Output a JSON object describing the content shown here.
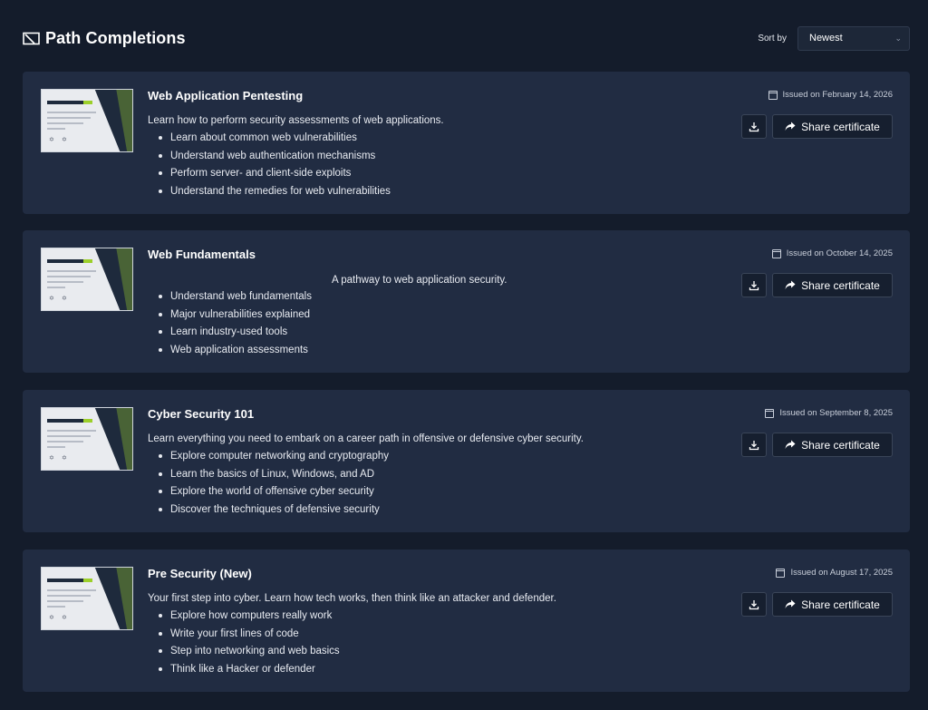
{
  "header": {
    "title": "Path Completions",
    "sort_label": "Sort by",
    "sort_value": "Newest"
  },
  "cards": [
    {
      "title": "Web Application Pentesting",
      "description": "Learn how to perform security assessments of web applications.",
      "bullets": [
        "Learn about common web vulnerabilities",
        "Understand web authentication mechanisms",
        "Perform server- and client-side exploits",
        "Understand the remedies for web vulnerabilities"
      ],
      "issued": "Issued on February 14, 2026",
      "share_label": "Share certificate"
    },
    {
      "title": "Web Fundamentals",
      "description": "A pathway to web application security.",
      "bullets": [
        "Understand web fundamentals",
        "Major vulnerabilities explained",
        "Learn industry-used tools",
        "Web application assessments"
      ],
      "issued": "Issued on October 14, 2025",
      "share_label": "Share certificate"
    },
    {
      "title": "Cyber Security 101",
      "description": "Learn everything you need to embark on a career path in offensive or defensive cyber security.",
      "bullets": [
        "Explore computer networking and cryptography",
        "Learn the basics of Linux, Windows, and AD",
        "Explore the world of offensive cyber security",
        "Discover the techniques of defensive security"
      ],
      "issued": "Issued on September 8, 2025",
      "share_label": "Share certificate"
    },
    {
      "title": "Pre Security (New)",
      "description": "Your first step into cyber. Learn how tech works, then think like an attacker and defender.",
      "bullets": [
        "Explore how computers really work",
        "Write your first lines of code",
        "Step into networking and web basics",
        "Think like a Hacker or defender"
      ],
      "issued": "Issued on August 17, 2025",
      "share_label": "Share certificate"
    }
  ],
  "icons": {
    "title": "certificate-icon",
    "issued": "calendar-icon",
    "download": "download-icon",
    "share": "share-arrow-icon"
  },
  "colors": {
    "background": "#141c2b",
    "card": "#212c42",
    "accent_green": "#9ccf2a"
  }
}
